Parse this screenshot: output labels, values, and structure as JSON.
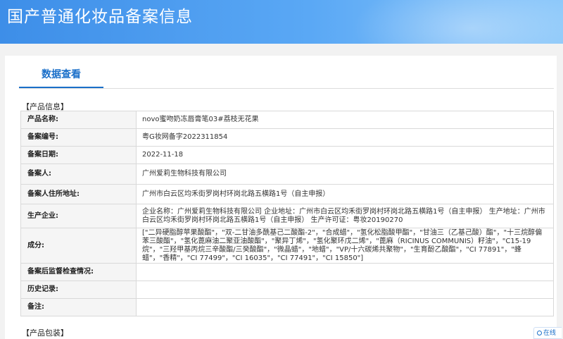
{
  "banner": {
    "title": "国产普通化妆品备案信息"
  },
  "tabs": [
    {
      "label": "数据查看"
    }
  ],
  "sections": {
    "product_info": "【产品信息】",
    "product_package": "【产品包装】"
  },
  "rows": [
    {
      "label": "产品名称:",
      "value": "novo蜜吻奶冻唇膏笔03#荔枝无花果"
    },
    {
      "label": "备案编号:",
      "value": "粤G妆网备字2022311854"
    },
    {
      "label": "备案日期:",
      "value": "2022-11-18"
    },
    {
      "label": "备案人:",
      "value": "广州爱莉生物科技有限公司"
    },
    {
      "label": "备案人住所地址:",
      "value": "广州市白云区均禾街罗岗村环岗北路五横路1号（自主申报）"
    },
    {
      "label": "生产企业:",
      "value": "企业名称：广州爱莉生物科技有限公司 企业地址：广州市白云区均禾街罗岗村环岗北路五横路1号（自主申报） 生产地址：广州市白云区均禾街罗岗村环岗北路五横路1号（自主申报） 生产许可证：粤妆20190270"
    },
    {
      "label": "成分:",
      "value": "[\"二异硬脂醇苹果酸酯\"，\"双-二甘油多酰基己二酸酯-2\"，\"合成蜡\"，\"氢化松脂酸甲酯\"，\"甘油三（乙基己酸）酯\"，\"十三烷醇偏苯三酸酯\"，\"氢化蓖麻油二聚亚油酸酯\"，\"聚异丁烯\"，\"氢化聚环戊二烯\"，\"蓖麻（RICINUS COMMUNIS）籽油\"，\"C15-19 烷\"，\"三羟甲基丙烷三辛酸酯/三癸酸酯\"，\"微晶蜡\"，\"地蜡\"，\"VP/十六碳烯共聚物\"，\"生育酚乙酸酯\"，\"CI 77891\"，\"蜂蜡\"，\"香精\"，\"CI 77499\"，\"CI 16035\"，\"CI 77491\"，\"CI 15850\"]"
    },
    {
      "label": "备案后监督检查情况:",
      "value": ""
    },
    {
      "label": "历史记录:",
      "value": ""
    },
    {
      "label": "备注:",
      "value": ""
    }
  ],
  "widget": {
    "label": "在线"
  }
}
